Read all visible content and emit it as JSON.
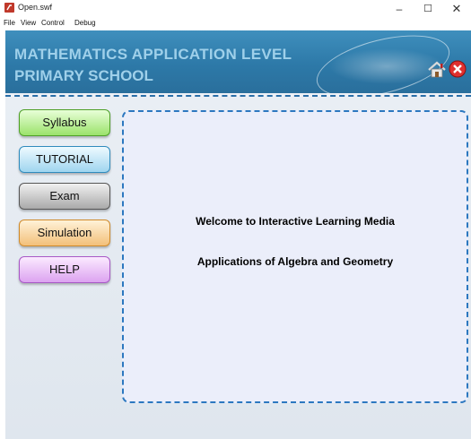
{
  "window": {
    "title": "Open.swf",
    "minimize_glyph": "–",
    "maximize_glyph": "☐",
    "close_glyph": "✕"
  },
  "menu": [
    "File",
    "View",
    "Control",
    "Debug"
  ],
  "banner": {
    "line1": "MATHEMATICS APPLICATION LEVEL",
    "line2": "PRIMARY SCHOOL",
    "home_icon": "home-icon",
    "exit_icon": "close-icon"
  },
  "nav": [
    {
      "label": "Syllabus",
      "color": "#9be36b"
    },
    {
      "label": "TUTORIAL",
      "color": "#9fd5ef"
    },
    {
      "label": "Exam",
      "color": "#a9a9a9"
    },
    {
      "label": "Simulation",
      "color": "#f3c07a"
    },
    {
      "label": "HELP",
      "color": "#dca3f0"
    }
  ],
  "panel": {
    "line1": "Welcome to Interactive Learning Media",
    "line2": "Applications of Algebra and Geometry"
  }
}
